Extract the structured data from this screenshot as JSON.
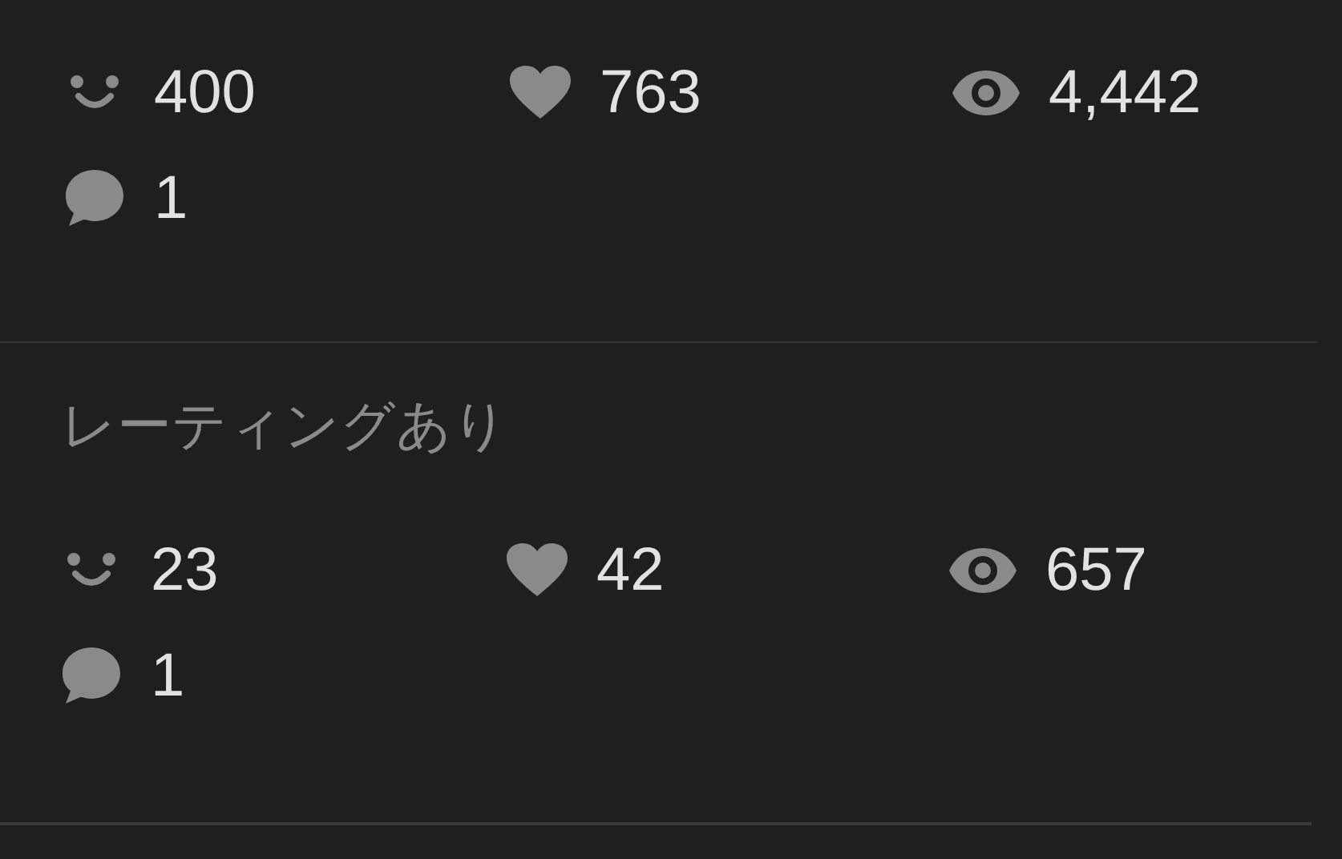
{
  "sections": [
    {
      "stats": [
        {
          "kind": "smile",
          "value": "400"
        },
        {
          "kind": "heart",
          "value": "763"
        },
        {
          "kind": "eye",
          "value": "4,442"
        },
        {
          "kind": "comment",
          "value": "1"
        }
      ]
    },
    {
      "title": "レーティングあり",
      "stats": [
        {
          "kind": "smile",
          "value": "23"
        },
        {
          "kind": "heart",
          "value": "42"
        },
        {
          "kind": "eye",
          "value": "657"
        },
        {
          "kind": "comment",
          "value": "1"
        }
      ]
    }
  ]
}
